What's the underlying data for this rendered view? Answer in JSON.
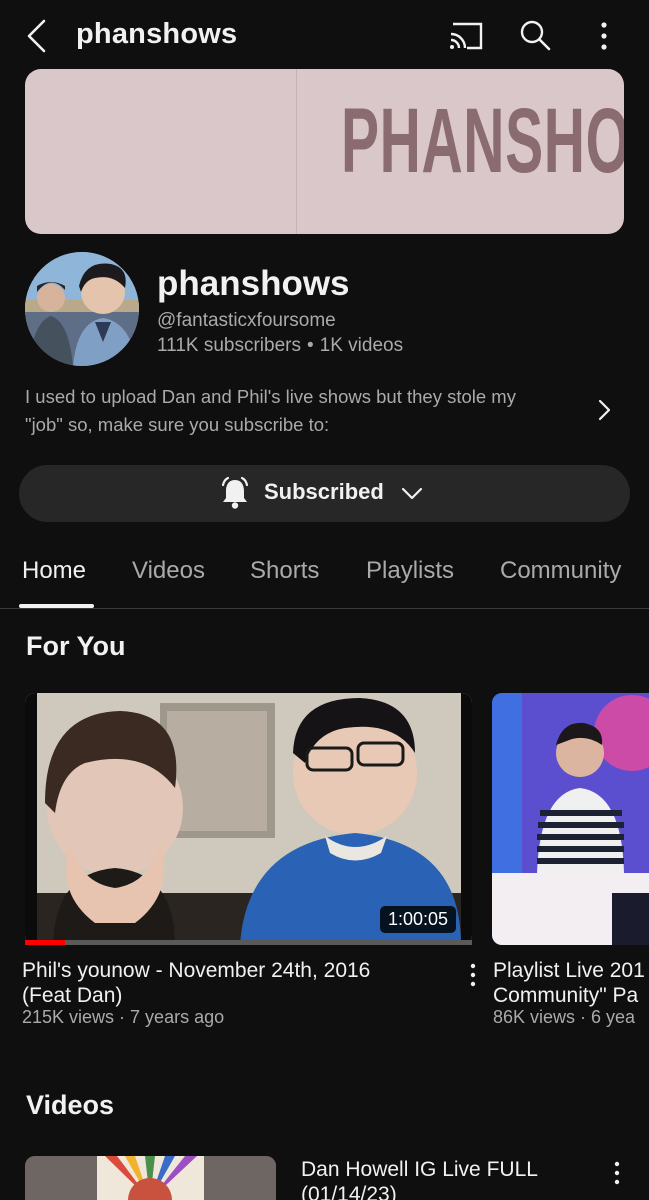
{
  "header": {
    "title": "phanshows"
  },
  "banner": {
    "text": "PHANSHO"
  },
  "channel": {
    "name": "phanshows",
    "handle": "@fantasticxfoursome",
    "subscribers": "111K subscribers",
    "separator": "•",
    "videos": "1K videos",
    "description_line1": "I used to upload Dan and Phil's live shows but they stole my",
    "description_line2": "\"job\" so, make sure you subscribe to:"
  },
  "subscribe": {
    "label": "Subscribed"
  },
  "tabs": [
    {
      "label": "Home"
    },
    {
      "label": "Videos"
    },
    {
      "label": "Shorts"
    },
    {
      "label": "Playlists"
    },
    {
      "label": "Community"
    }
  ],
  "for_you": {
    "title": "For You",
    "items": [
      {
        "title_line1": "Phil's younow - November 24th, 2016",
        "title_line2": "(Feat  Dan)",
        "meta": "215K views · 7 years ago",
        "duration": "1:00:05",
        "watched_fraction": 0.09
      },
      {
        "title_line1": "Playlist Live 201",
        "title_line2": "Community\" Pa",
        "meta": "86K views · 6 yea"
      }
    ]
  },
  "videos_section": {
    "title": "Videos",
    "items": [
      {
        "title_line1": "Dan Howell IG Live FULL",
        "title_line2": "(01/14/23)"
      }
    ]
  },
  "colors": {
    "background": "#0f0f0f",
    "accent": "#ff0000",
    "banner": "#d9c7c9",
    "banner_text": "#8a6b6f"
  }
}
